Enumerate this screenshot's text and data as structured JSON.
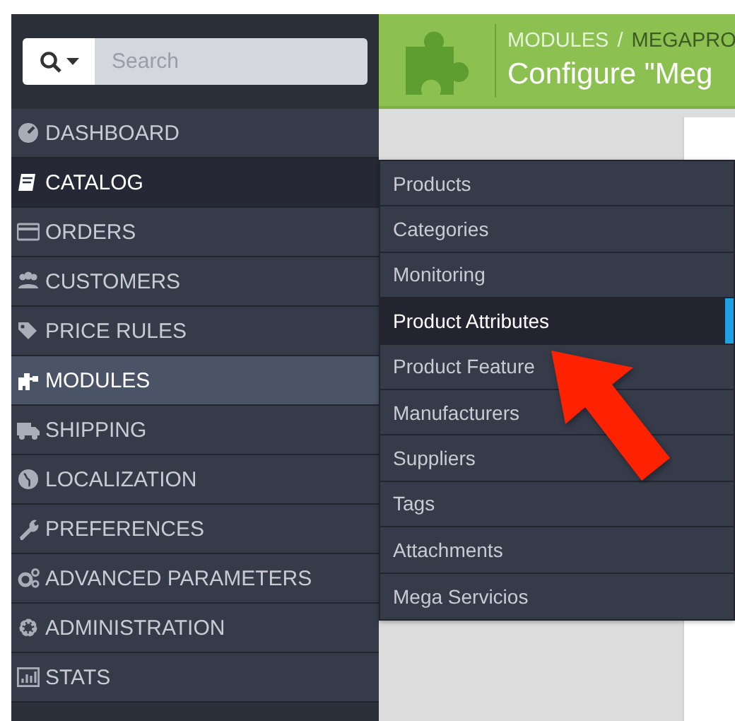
{
  "search": {
    "placeholder": "Search"
  },
  "sidebar": {
    "items": [
      {
        "label": "DASHBOARD",
        "selected": false,
        "expanded": false
      },
      {
        "label": "CATALOG",
        "selected": false,
        "expanded": true
      },
      {
        "label": "ORDERS",
        "selected": false,
        "expanded": false
      },
      {
        "label": "CUSTOMERS",
        "selected": false,
        "expanded": false
      },
      {
        "label": "PRICE RULES",
        "selected": false,
        "expanded": false
      },
      {
        "label": "MODULES",
        "selected": true,
        "expanded": false
      },
      {
        "label": "SHIPPING",
        "selected": false,
        "expanded": false
      },
      {
        "label": "LOCALIZATION",
        "selected": false,
        "expanded": false
      },
      {
        "label": "PREFERENCES",
        "selected": false,
        "expanded": false
      },
      {
        "label": "ADVANCED PARAMETERS",
        "selected": false,
        "expanded": false
      },
      {
        "label": "ADMINISTRATION",
        "selected": false,
        "expanded": false
      },
      {
        "label": "STATS",
        "selected": false,
        "expanded": false
      }
    ]
  },
  "header": {
    "breadcrumb": [
      "MODULES",
      "/",
      "MEGAPRO"
    ],
    "title": "Configure \"Meg"
  },
  "submenu": {
    "items": [
      {
        "label": "Products",
        "selected": false
      },
      {
        "label": "Categories",
        "selected": false
      },
      {
        "label": "Monitoring",
        "selected": false
      },
      {
        "label": "Product Attributes",
        "selected": true
      },
      {
        "label": "Product Feature",
        "selected": false
      },
      {
        "label": "Manufacturers",
        "selected": false
      },
      {
        "label": "Suppliers",
        "selected": false
      },
      {
        "label": "Tags",
        "selected": false
      },
      {
        "label": "Attachments",
        "selected": false
      },
      {
        "label": "Mega Servicios",
        "selected": false
      }
    ]
  }
}
